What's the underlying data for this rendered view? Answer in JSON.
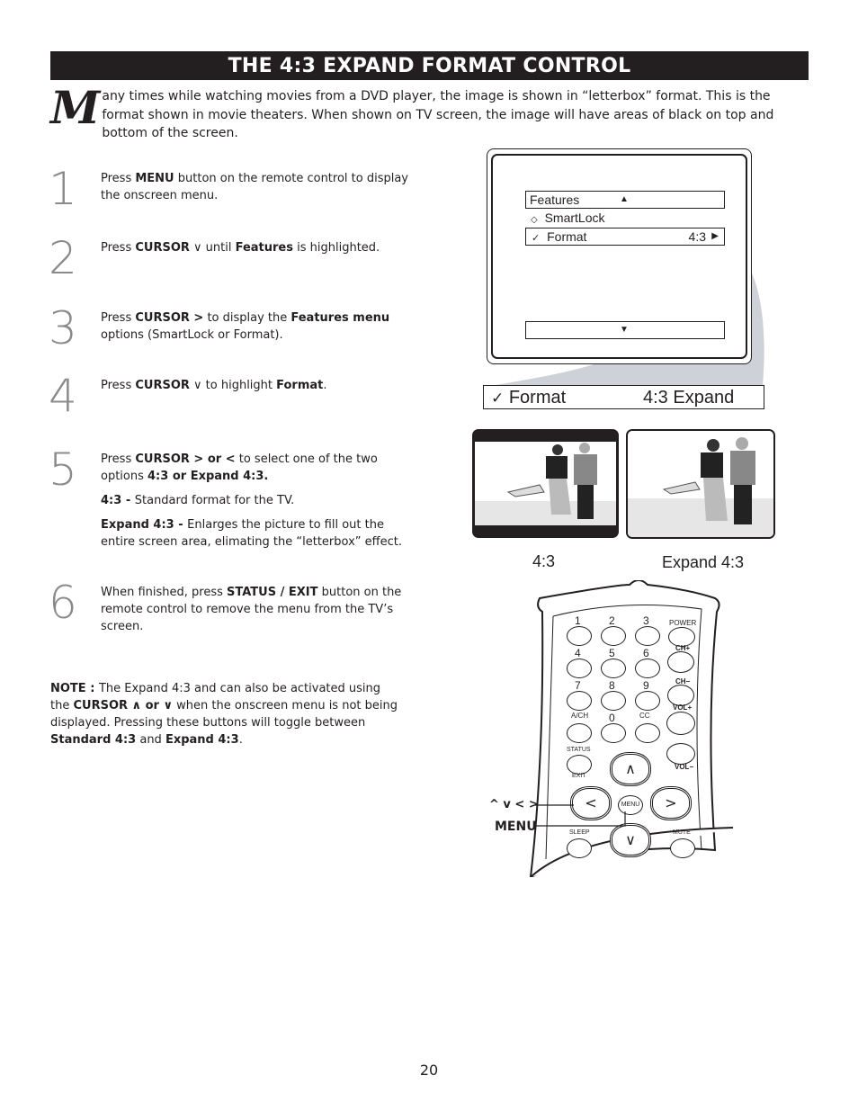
{
  "title": "THE 4:3 EXPAND FORMAT CONTROL",
  "intro": {
    "dropcap": "M",
    "text": "any times while watching movies from a DVD player, the image is shown in “letterbox” format.  This is the format shown in movie theaters.  When shown on TV screen, the image will have areas of black on top and bottom of the screen."
  },
  "steps": [
    {
      "num": "1",
      "parts": [
        {
          "t": "Press "
        },
        {
          "b": "MENU"
        },
        {
          "t": " button on the remote control to display the onscreen menu."
        }
      ]
    },
    {
      "num": "2",
      "parts": [
        {
          "t": "Press "
        },
        {
          "b": "CURSOR"
        },
        {
          "t": "  ∨ until "
        },
        {
          "b": "Features"
        },
        {
          "t": " is highlighted."
        }
      ]
    },
    {
      "num": "3",
      "parts": [
        {
          "t": "Press "
        },
        {
          "b": "CURSOR  >"
        },
        {
          "t": "  to display the "
        },
        {
          "b": "Features menu"
        },
        {
          "t": " options (SmartLock or Format)."
        }
      ]
    },
    {
      "num": "4",
      "parts": [
        {
          "t": "Press "
        },
        {
          "b": "CURSOR"
        },
        {
          "t": " ∨ to highlight "
        },
        {
          "b": "Format"
        },
        {
          "t": "."
        }
      ]
    },
    {
      "num": "5",
      "parts": [
        {
          "t": "Press "
        },
        {
          "b": "CURSOR > or <"
        },
        {
          "t": " to select one of the two options "
        },
        {
          "b": "4:3 or Expand 4:3."
        }
      ],
      "extra": [
        [
          {
            "b": "4:3 - "
          },
          {
            "t": "Standard format for the TV."
          }
        ],
        [
          {
            "b": "Expand 4:3  -  "
          },
          {
            "t": "Enlarges the picture to fill out the entire screen area, elimating the “letterbox” effect."
          }
        ]
      ]
    },
    {
      "num": "6",
      "parts": [
        {
          "t": "When finished, press "
        },
        {
          "b": "STATUS / EXIT"
        },
        {
          "t": " button on the remote control to remove the menu from the TV’s screen."
        }
      ]
    }
  ],
  "note": [
    {
      "b": "NOTE : "
    },
    {
      "t": "The Expand 4:3 and can also be activated using the "
    },
    {
      "b": "CURSOR ∧ or ∨"
    },
    {
      "t": " when the onscreen menu is not being displayed.  Pressing these buttons will toggle between "
    },
    {
      "b": "Standard 4:3"
    },
    {
      "t": " and "
    },
    {
      "b": "Expand 4:3"
    },
    {
      "t": "."
    }
  ],
  "tv_menu": {
    "header": "Features",
    "header_icon": "up-triangle",
    "items": [
      {
        "icon": "diamond",
        "label": "SmartLock",
        "value": ""
      },
      {
        "icon": "checkmark",
        "label": "Format",
        "value": "4:3",
        "arrow": "right-triangle"
      }
    ],
    "footer_icon": "down-triangle"
  },
  "format_banner": {
    "icon": "checkmark",
    "label": "Format",
    "value": "4:3 Expand"
  },
  "pictures": [
    {
      "label": "4:3",
      "letterbox": true
    },
    {
      "label": "Expand 4:3",
      "letterbox": false
    }
  ],
  "remote": {
    "number_keys": [
      "1",
      "2",
      "3",
      "4",
      "5",
      "6",
      "7",
      "8",
      "9",
      "A/CH",
      "0",
      "CC"
    ],
    "power": "POWER",
    "ch_plus": "CH+",
    "ch_minus": "CH−",
    "vol_plus": "VOL+",
    "vol_minus": "VOL−",
    "status": "STATUS",
    "exit": "EXIT",
    "menu": "MENU",
    "sleep": "SLEEP",
    "mute": "MUTE",
    "callout_cursor": "^ v < >",
    "callout_menu": "MENU"
  },
  "page_number": "20"
}
